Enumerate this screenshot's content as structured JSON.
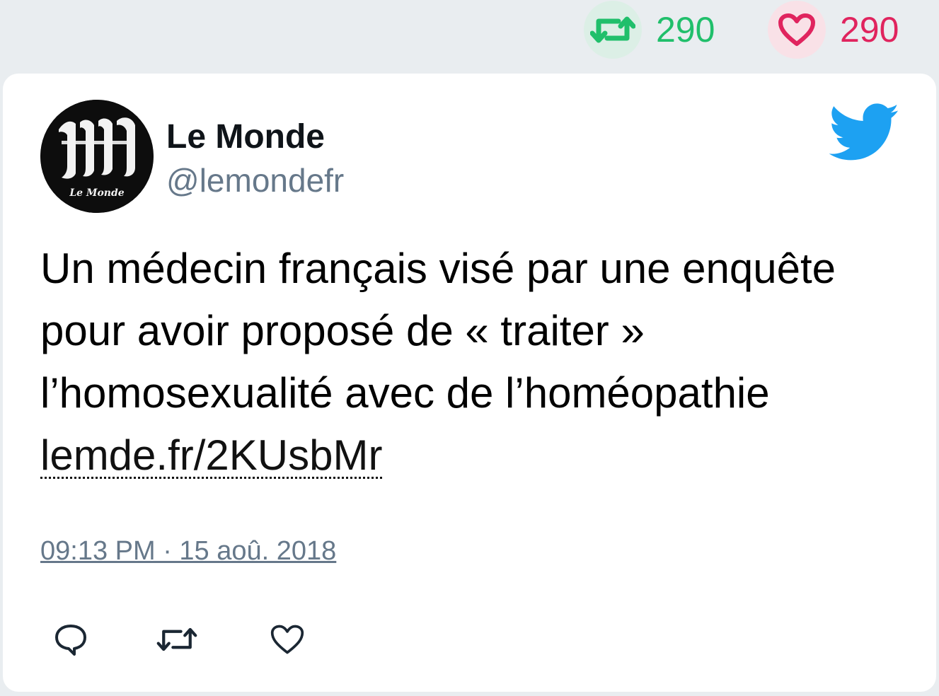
{
  "stats": {
    "retweets": "290",
    "likes": "290",
    "colors": {
      "retweet": "#20bf6b",
      "like": "#e0245e"
    }
  },
  "tweet": {
    "author": {
      "name": "Le Monde",
      "handle": "@lemondefr",
      "avatar_icon": "le-monde-logo"
    },
    "text": "Un médecin français visé par une enquête pour avoir proposé de « traiter » l’homosexualité avec de l’homéopathie",
    "link": "lemde.fr/2KUsbMr",
    "timestamp": "09:13 PM · 15 aoû. 2018"
  },
  "actions": [
    "reply-icon",
    "retweet-icon",
    "like-icon"
  ]
}
